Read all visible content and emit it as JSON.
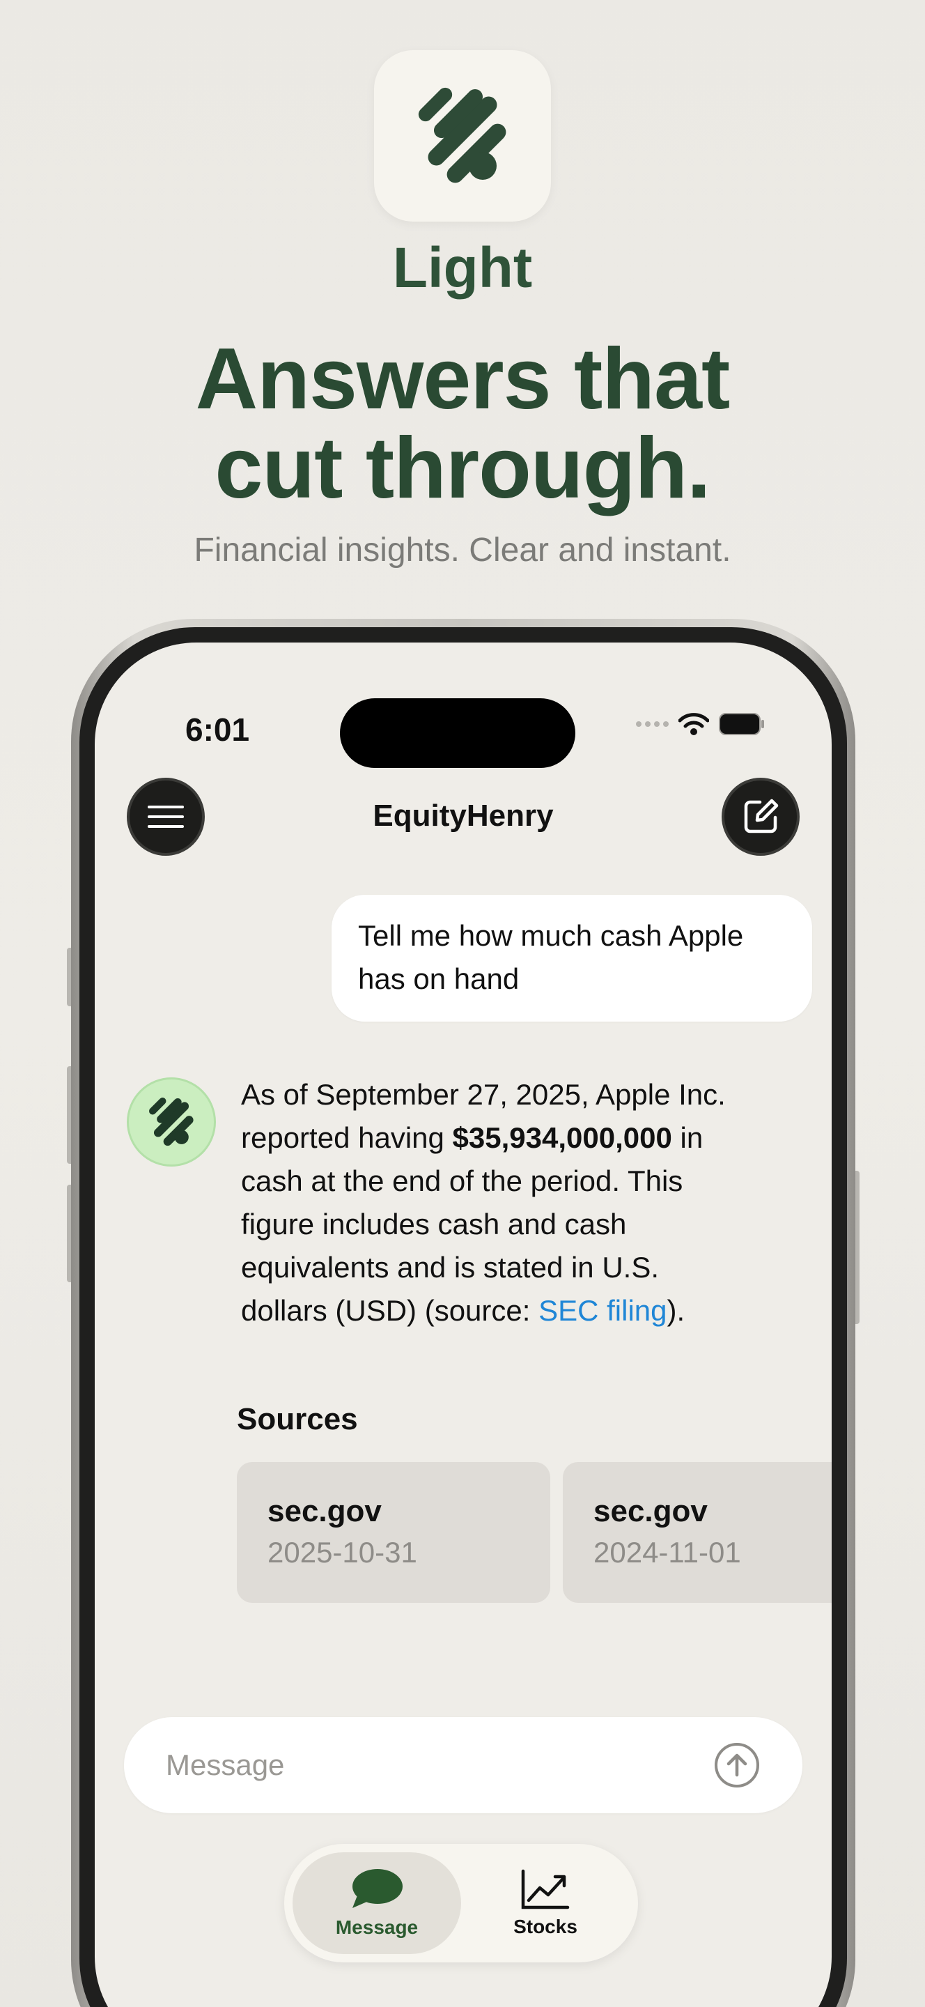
{
  "hero": {
    "app_name": "Light",
    "headline_line1": "Answers that",
    "headline_line2": "cut through.",
    "tagline": "Financial insights. Clear and instant."
  },
  "status_bar": {
    "time": "6:01"
  },
  "nav": {
    "title": "EquityHenry",
    "menu_icon": "hamburger-icon",
    "compose_icon": "compose-icon"
  },
  "chat": {
    "user_message": "Tell me how much cash Apple has on hand",
    "assistant": {
      "part1": "As of September 27, 2025, Apple Inc. reported having ",
      "amount": "$35,934,000,000",
      "part2": " in cash at the end of the period. This figure includes cash and cash equivalents and is stated in U.S. dollars (USD) (source: ",
      "link_text": "SEC filing",
      "part3": ")."
    },
    "sources_title": "Sources",
    "sources": [
      {
        "domain": "sec.gov",
        "date": "2025-10-31"
      },
      {
        "domain": "sec.gov",
        "date": "2024-11-01"
      }
    ]
  },
  "input": {
    "placeholder": "Message"
  },
  "tabs": [
    {
      "label": "Message",
      "icon": "chat-bubble-icon"
    },
    {
      "label": "Stocks",
      "icon": "chart-line-icon"
    }
  ],
  "colors": {
    "brand_green": "#2a4a33",
    "avatar_bg": "#cbeec0",
    "link_blue": "#1f86d6",
    "background": "#eeece7"
  }
}
